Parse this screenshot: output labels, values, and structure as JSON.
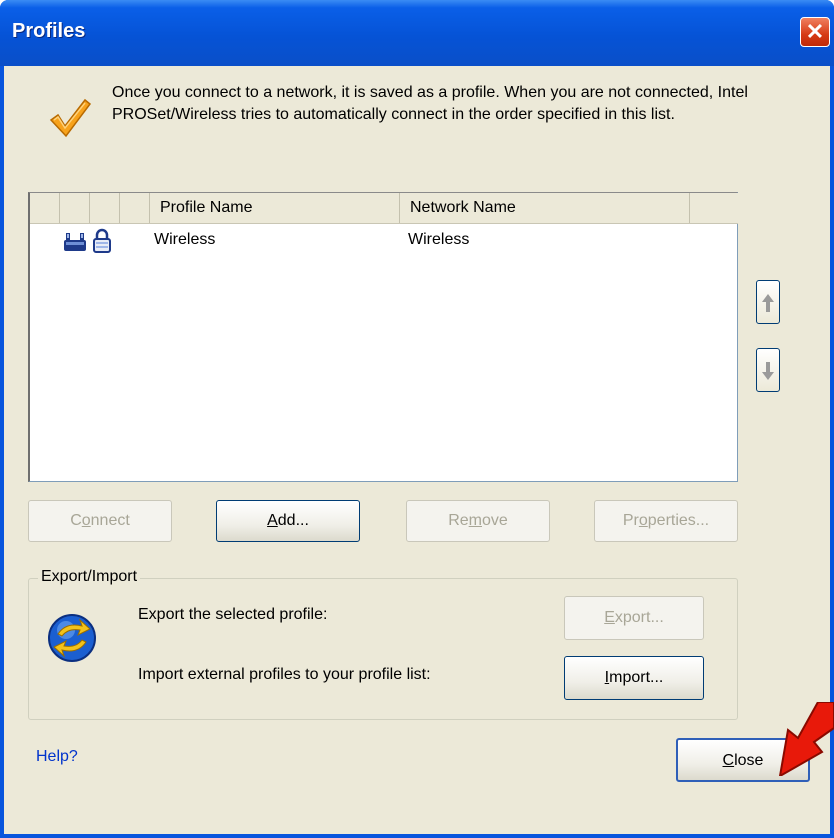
{
  "window": {
    "title": "Profiles",
    "close_glyph": "✕"
  },
  "intro": {
    "icon": "checkmark-icon",
    "text": "Once you connect to a network, it is saved as a profile. When you are not connected, Intel PROSet/Wireless tries to automatically connect in the order specified in this list."
  },
  "list": {
    "columns": [
      "Profile Name",
      "Network Name"
    ],
    "rows": [
      {
        "icons": [
          "network-adapter-icon",
          "lock-icon"
        ],
        "profile_name": "Wireless",
        "network_name": "Wireless"
      }
    ]
  },
  "buttons": {
    "connect": {
      "pre": "C",
      "u": "o",
      "post": "nnect"
    },
    "add": {
      "pre": "",
      "u": "A",
      "post": "dd..."
    },
    "remove": {
      "pre": "Re",
      "u": "m",
      "post": "ove"
    },
    "properties": {
      "pre": "Pr",
      "u": "o",
      "post": "perties..."
    },
    "export": {
      "pre": "",
      "u": "E",
      "post": "xport..."
    },
    "import": {
      "pre": "",
      "u": "I",
      "post": "mport..."
    },
    "close": {
      "pre": "",
      "u": "C",
      "post": "lose"
    }
  },
  "export_import": {
    "title": "Export/Import",
    "export_label": "Export the selected profile:",
    "import_label": "Import external profiles to your profile list:"
  },
  "help": {
    "label": "Help?"
  },
  "colors": {
    "titlebar": "#0653d6",
    "face": "#ece9d8",
    "link": "#0033cc",
    "pointer": "#e8190a"
  }
}
